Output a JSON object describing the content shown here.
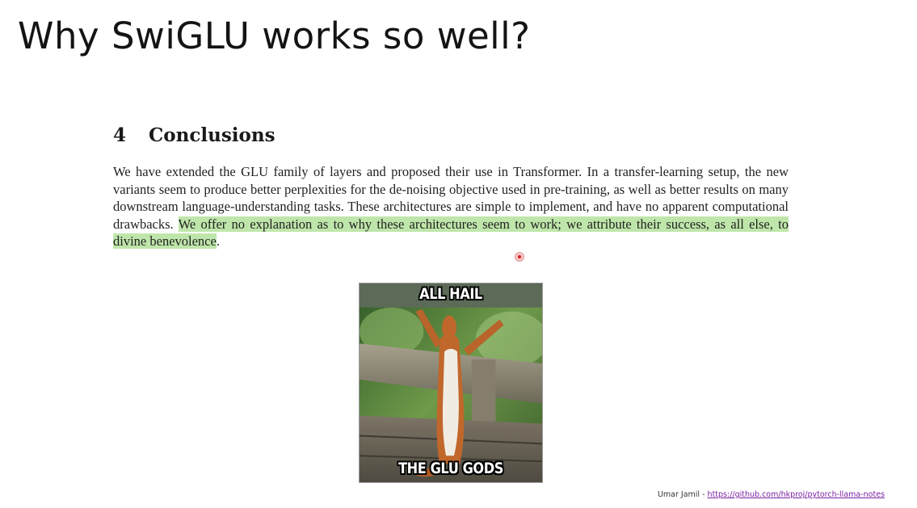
{
  "slide": {
    "title": "Why SwiGLU works so well?"
  },
  "section": {
    "number": "4",
    "heading": "Conclusions"
  },
  "paragraph": {
    "plain": "We have extended the GLU family of layers and proposed their use in Transformer. In a transfer-learning setup, the new variants seem to produce better perplexities for the de-noising objective used in pre-training, as well as better results on many downstream language-understanding tasks. These architectures are simple to implement, and have no apparent computational drawbacks. ",
    "highlighted": "We offer no explanation as to why these architectures seem to work; we attribute their success, as all else, to divine benevolence",
    "end": "."
  },
  "meme": {
    "top_caption": "ALL HAIL",
    "bottom_caption": "THE GLU GODS"
  },
  "footer": {
    "author": "Umar Jamil - ",
    "link": "https://github.com/hkproj/pytorch-llama-notes"
  },
  "colors": {
    "highlight": "#bfe6aa",
    "link": "#7a1fa2",
    "cursor": "#d81b1b"
  }
}
